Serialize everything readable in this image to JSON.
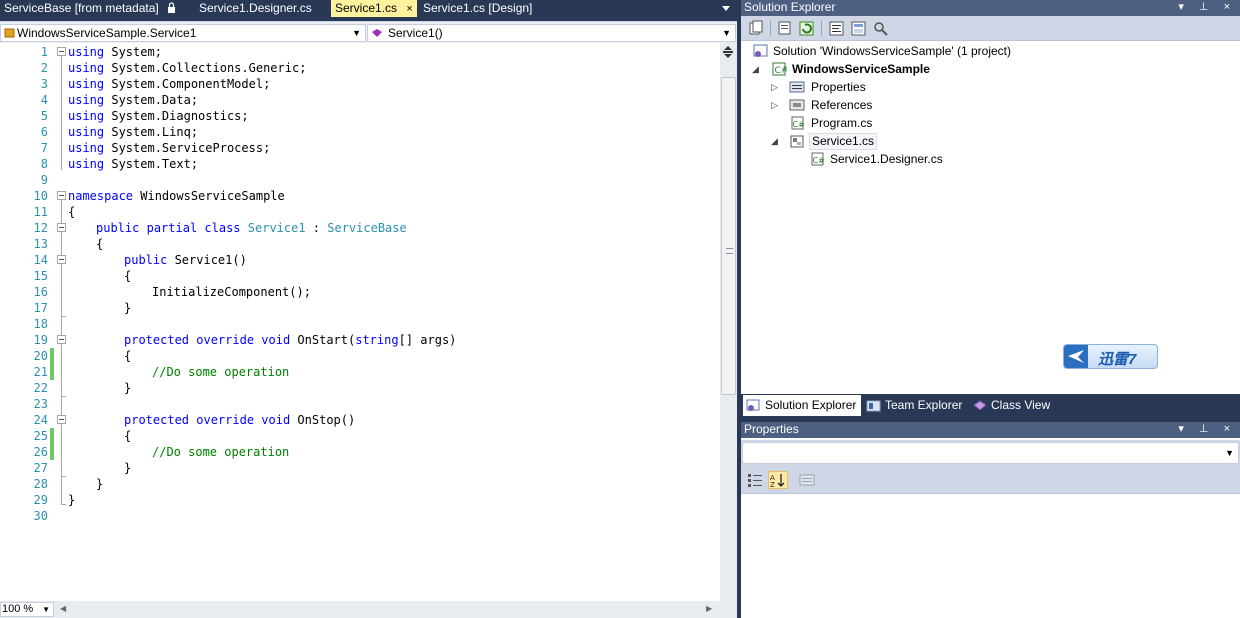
{
  "editor": {
    "tabs": [
      {
        "label": "ServiceBase [from metadata]",
        "locked": true,
        "active": false
      },
      {
        "label": "Service1.Designer.cs",
        "active": false
      },
      {
        "label": "Service1.cs",
        "active": true,
        "close": "×"
      },
      {
        "label": "Service1.cs [Design]",
        "active": false
      }
    ],
    "type_combo": "WindowsServiceSample.Service1",
    "member_combo": "Service1()",
    "zoom": "100 %",
    "lines": [
      {
        "n": "1"
      },
      {
        "n": "2"
      },
      {
        "n": "3"
      },
      {
        "n": "4"
      },
      {
        "n": "5"
      },
      {
        "n": "6"
      },
      {
        "n": "7"
      },
      {
        "n": "8"
      },
      {
        "n": "9"
      },
      {
        "n": "10"
      },
      {
        "n": "11"
      },
      {
        "n": "12"
      },
      {
        "n": "13"
      },
      {
        "n": "14"
      },
      {
        "n": "15"
      },
      {
        "n": "16"
      },
      {
        "n": "17"
      },
      {
        "n": "18"
      },
      {
        "n": "19"
      },
      {
        "n": "20"
      },
      {
        "n": "21"
      },
      {
        "n": "22"
      },
      {
        "n": "23"
      },
      {
        "n": "24"
      },
      {
        "n": "25"
      },
      {
        "n": "26"
      },
      {
        "n": "27"
      },
      {
        "n": "28"
      },
      {
        "n": "29"
      },
      {
        "n": "30"
      }
    ],
    "code": {
      "kw_using": "using",
      "ns_system": " System;",
      "ns_collections": " System.Collections.Generic;",
      "ns_componentmodel": " System.ComponentModel;",
      "ns_data": " System.Data;",
      "ns_diagnostics": " System.Diagnostics;",
      "ns_linq": " System.Linq;",
      "ns_serviceprocess": " System.ServiceProcess;",
      "ns_text": " System.Text;",
      "kw_namespace": "namespace",
      "namespace_name": " WindowsServiceSample",
      "open_brace": "{",
      "close_brace": "}",
      "kw_public": "public",
      "kw_partial": "partial",
      "kw_class": "class",
      "class_name": "Service1",
      "colon": " : ",
      "base_name": "ServiceBase",
      "ctor_sig": " Service1()",
      "init_call": "InitializeComponent();",
      "kw_protected": "protected",
      "kw_override": "override",
      "kw_void": "void",
      "onstart": " OnStart(",
      "kw_string": "string",
      "onstart_args": "[] args)",
      "onstop": " OnStop()",
      "comment": "//Do some operation"
    }
  },
  "solution_explorer": {
    "title": "Solution Explorer",
    "title_buttons": "▾ ⊥ ×",
    "tree": {
      "solution": "Solution 'WindowsServiceSample' (1 project)",
      "project": "WindowsServiceSample",
      "properties": "Properties",
      "references": "References",
      "program": "Program.cs",
      "service": "Service1.cs",
      "designer": "Service1.Designer.cs"
    },
    "badge": "迅雷7",
    "tabs": [
      "Solution Explorer",
      "Team Explorer",
      "Class View"
    ]
  },
  "properties": {
    "title": "Properties",
    "title_buttons": "▾ ⊥ ×"
  },
  "colors": {
    "keyword": "#0000ff",
    "type": "#2b91af",
    "comment": "#008000",
    "line_number": "#2b91af",
    "active_tab": "#fff29d",
    "chrome": "#293955",
    "title_bar": "#4d6082",
    "change_marker": "#6cc864"
  }
}
